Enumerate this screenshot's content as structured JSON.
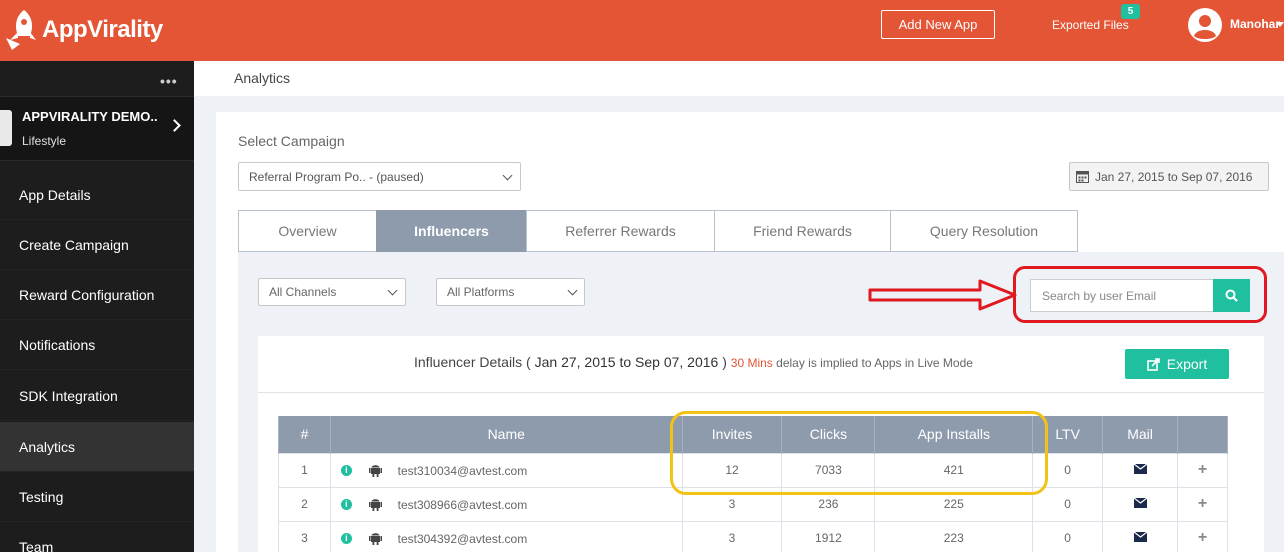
{
  "brand": {
    "name": "AppVirality",
    "accent": "#e35535",
    "teal": "#1fbf9f"
  },
  "header": {
    "add_app_label": "Add New App",
    "exported_label": "Exported Files",
    "exported_count": "5",
    "user_name": "Manohar"
  },
  "sidebar": {
    "dots": "•••",
    "app": {
      "name": "APPVIRALITY DEMO..",
      "category": "Lifestyle"
    },
    "items": [
      {
        "label": "App Details"
      },
      {
        "label": "Create Campaign"
      },
      {
        "label": "Reward Configuration"
      },
      {
        "label": "Notifications"
      },
      {
        "label": "SDK Integration"
      },
      {
        "label": "Analytics"
      },
      {
        "label": "Testing"
      },
      {
        "label": "Team"
      }
    ],
    "active": "Analytics"
  },
  "breadcrumb": "Analytics",
  "campaign": {
    "label": "Select Campaign",
    "selected": "Referral Program Po.. - (paused)",
    "date_range": "Jan 27, 2015 to Sep 07, 2016"
  },
  "tabs": [
    {
      "label": "Overview"
    },
    {
      "label": "Influencers"
    },
    {
      "label": "Referrer Rewards"
    },
    {
      "label": "Friend Rewards"
    },
    {
      "label": "Query Resolution"
    }
  ],
  "active_tab": "Influencers",
  "filters": {
    "channels": "All Channels",
    "platforms": "All Platforms",
    "search_placeholder": "Search by user Email"
  },
  "details": {
    "title_prefix": "Influencer Details ( ",
    "title_range": "Jan 27, 2015 to Sep 07, 2016",
    "title_suffix": " )",
    "delay_highlight": "30 Mins",
    "delay_text": " delay is implied to Apps in Live Mode",
    "export_label": "Export"
  },
  "table": {
    "columns": [
      "#",
      "Name",
      "Invites",
      "Clicks",
      "App Installs",
      "LTV",
      "Mail",
      ""
    ],
    "rows": [
      {
        "num": "1",
        "email": "test310034@avtest.com",
        "invites": "12",
        "clicks": "7033",
        "installs": "421",
        "ltv": "0"
      },
      {
        "num": "2",
        "email": "test308966@avtest.com",
        "invites": "3",
        "clicks": "236",
        "installs": "225",
        "ltv": "0"
      },
      {
        "num": "3",
        "email": "test304392@avtest.com",
        "invites": "3",
        "clicks": "1912",
        "installs": "223",
        "ltv": "0"
      }
    ]
  },
  "annotations": {
    "highlight_red": "#e01820",
    "highlight_yellow": "#f3c217"
  }
}
